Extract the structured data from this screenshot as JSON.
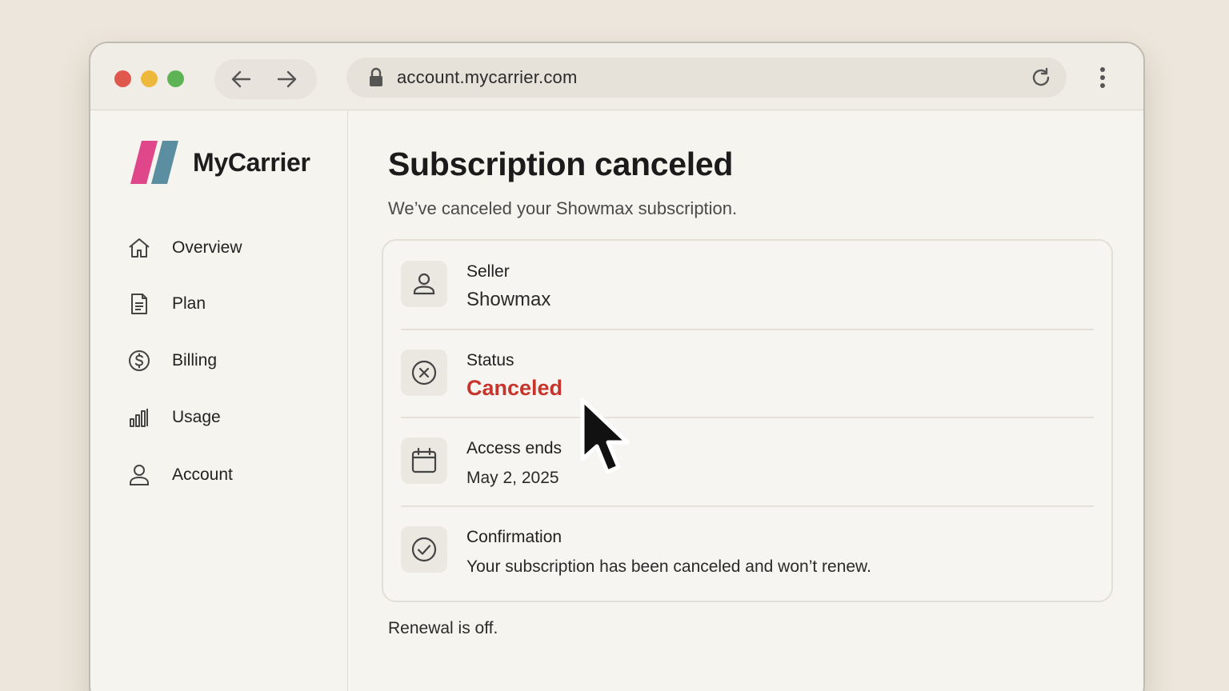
{
  "browser": {
    "url": "account.mycarrier.com"
  },
  "sidebar": {
    "brand": "MyCarrier",
    "items": [
      {
        "label": "Overview",
        "icon": "home-icon"
      },
      {
        "label": "Plan",
        "icon": "document-icon"
      },
      {
        "label": "Billing",
        "icon": "dollar-icon"
      },
      {
        "label": "Usage",
        "icon": "bar-chart-icon"
      },
      {
        "label": "Account",
        "icon": "user-icon"
      }
    ]
  },
  "main": {
    "title": "Subscription canceled",
    "subtitle": "We’ve canceled your Showmax subscription.",
    "details": [
      {
        "label": "Seller",
        "value": "Showmax",
        "icon": "user-icon"
      },
      {
        "label": "Status",
        "value": "Canceled",
        "icon": "x-circle-icon"
      },
      {
        "label": "Access ends",
        "value": "May 2, 2025",
        "icon": "calendar-icon"
      },
      {
        "label": "Confirmation",
        "value": "Your subscription has been canceled and won’t renew.",
        "icon": "check-circle-icon"
      }
    ],
    "footer_note": "Renewal is off."
  },
  "colors": {
    "status_canceled": "#c6342c",
    "brand_pink": "#e0478a",
    "brand_teal": "#5b8ea0"
  }
}
